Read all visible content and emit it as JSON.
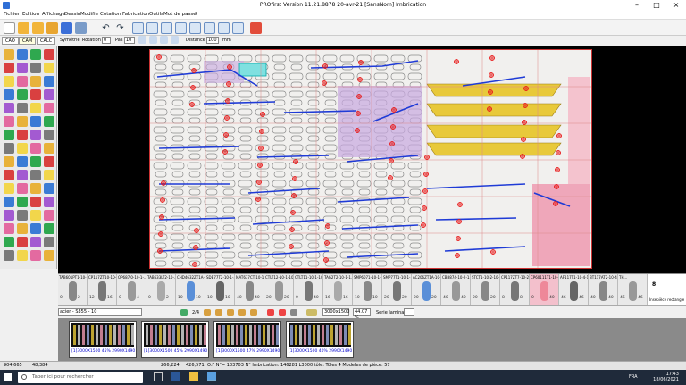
{
  "window": {
    "title": "PROfirst Version 11.21.8878     20-avr-21 [SansNom] Imbrication"
  },
  "menu": [
    "Fichier",
    "Edition",
    "Affichage",
    "Dessin",
    "Modifie",
    "Cotation",
    "Fabrication",
    "Outils",
    "Mot de passe",
    "?"
  ],
  "tabs": [
    "CAO",
    "CAM",
    "CALC"
  ],
  "toolbar2": {
    "symetrie": "Symétrie",
    "rotation": "Rotation",
    "rotation_value": "0",
    "pas_label": "Pas",
    "pas_value": "10",
    "distance_label": "Distance",
    "distance_value": "100",
    "distance_unit": "mm"
  },
  "pieces": [
    {
      "label": "TAB601PT1-10-...",
      "q1": "0",
      "q2": "2"
    },
    {
      "label": "CP117ZT10-10-...",
      "q1": "12",
      "q2": "16"
    },
    {
      "label": "OP687I0-10-1-...",
      "q1": "0",
      "q2": "4"
    },
    {
      "label": "TAB633LT2-10-...",
      "q1": "0",
      "q2": "2"
    },
    {
      "label": "CHD4632ZT1A-10-...",
      "q1": "10",
      "q2": "10"
    },
    {
      "label": "SDB77T2-10-1-...",
      "q1": "10",
      "q2": "10"
    },
    {
      "label": "MAT637CT-10-1-...",
      "q1": "40",
      "q2": "40"
    },
    {
      "label": "CTLT12-10-1-10-...",
      "q1": "20",
      "q2": "20"
    },
    {
      "label": "CTLT11-10-1-10-...",
      "q1": "0",
      "q2": "40"
    },
    {
      "label": "TAG2T2-10-1-1...",
      "q1": "16",
      "q2": "16"
    },
    {
      "label": "SMP6071-10-1-...",
      "q1": "10",
      "q2": "10"
    },
    {
      "label": "SMP77T1-10-1-...",
      "q1": "20",
      "q2": "20"
    },
    {
      "label": "AC206ZT1A-10-...",
      "q1": "20",
      "q2": "20"
    },
    {
      "label": "CBB874-10-2-1...",
      "q1": "40",
      "q2": "40"
    },
    {
      "label": "STCT1-10-2-10-...",
      "q1": "20",
      "q2": "20"
    },
    {
      "label": "CP117ZT7-10-2-...",
      "q1": "8",
      "q2": "8"
    },
    {
      "label": "CP60111T1-10-...",
      "q1": "0",
      "q2": "40"
    },
    {
      "label": "AF117T1-10-4-1...",
      "q1": "46",
      "q2": "46"
    },
    {
      "label": "BT117AT2-10-4-...",
      "q1": "40",
      "q2": "40"
    },
    {
      "label": "TH...",
      "q1": "46",
      "q2": "46"
    }
  ],
  "piece_right": {
    "label": "Insepièce rectangle",
    "qty": "8"
  },
  "ctrlbar": {
    "material": "acier - S355 - 10",
    "page": "2/4",
    "sheet_size": "3000x1500",
    "percent": "44.07 %",
    "serie_label": "Serie laminage:"
  },
  "layouts": [
    {
      "caption": "[1]3000X1500 45% 2990X1490"
    },
    {
      "caption": "[1]3000X1500 45% 2990X1490"
    },
    {
      "caption": "[1]3000X1500 47% 2990X1490"
    },
    {
      "caption": "[1]3000X1500 40% 2990X1490"
    }
  ],
  "status": {
    "coord_x": "904,665",
    "coord_y": "48,384",
    "v1": "266,224",
    "v2": "426,571",
    "message": "O.F N°= 103703 N° Imbrication: 146281 L3000 tôle: Töles 4 Modeles de pièce: 57"
  },
  "taskbar": {
    "search_placeholder": "Taper ici pour rechercher",
    "lang": "FRA",
    "time": "17:43",
    "date": "18/06/2021"
  },
  "colors": {
    "sheet_border": "#cc3333",
    "parts_yellow": "#e8c93a",
    "parts_purple": "#c8a8e0",
    "parts_pink": "#ef9ab0",
    "toolpath_blue": "#1f3bd6",
    "pierce_red": "#e81a1a"
  }
}
